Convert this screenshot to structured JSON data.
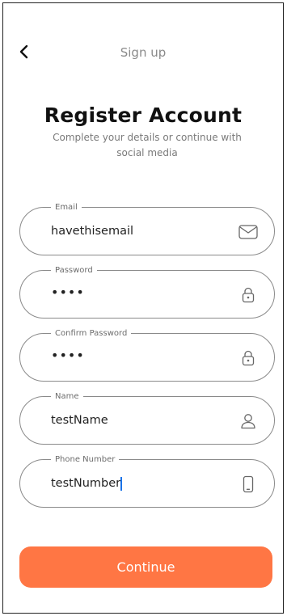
{
  "header": {
    "title": "Sign up",
    "back_icon": "chevron-left-icon"
  },
  "main": {
    "heading": "Register Account",
    "subtitle": "Complete your details or continue with social media"
  },
  "form": {
    "email": {
      "label": "Email",
      "value": "havethisemail",
      "icon": "mail-icon"
    },
    "password": {
      "label": "Password",
      "value": "••••",
      "icon": "lock-icon"
    },
    "confirm_password": {
      "label": "Confirm Password",
      "value": "••••",
      "icon": "lock-icon"
    },
    "name": {
      "label": "Name",
      "value": "testName",
      "icon": "user-icon"
    },
    "phone": {
      "label": "Phone Number",
      "value": "testNumber",
      "icon": "phone-icon"
    }
  },
  "actions": {
    "continue_label": "Continue"
  },
  "colors": {
    "accent": "#ff7644",
    "field_border": "#8a8a8a",
    "caret": "#1a73e8"
  }
}
